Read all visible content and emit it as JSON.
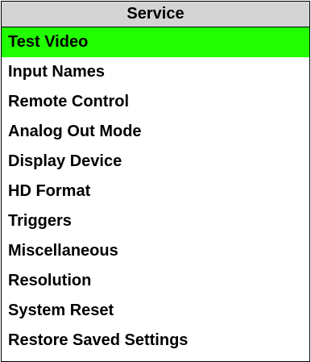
{
  "menu": {
    "title": "Service",
    "highlight_color": "#22ff00",
    "selected_index": 0,
    "items": [
      {
        "label": "Test Video"
      },
      {
        "label": "Input Names"
      },
      {
        "label": "Remote Control"
      },
      {
        "label": "Analog Out Mode"
      },
      {
        "label": "Display Device"
      },
      {
        "label": "HD Format"
      },
      {
        "label": "Triggers"
      },
      {
        "label": "Miscellaneous"
      },
      {
        "label": "Resolution"
      },
      {
        "label": "System Reset"
      },
      {
        "label": "Restore Saved Settings"
      }
    ]
  }
}
